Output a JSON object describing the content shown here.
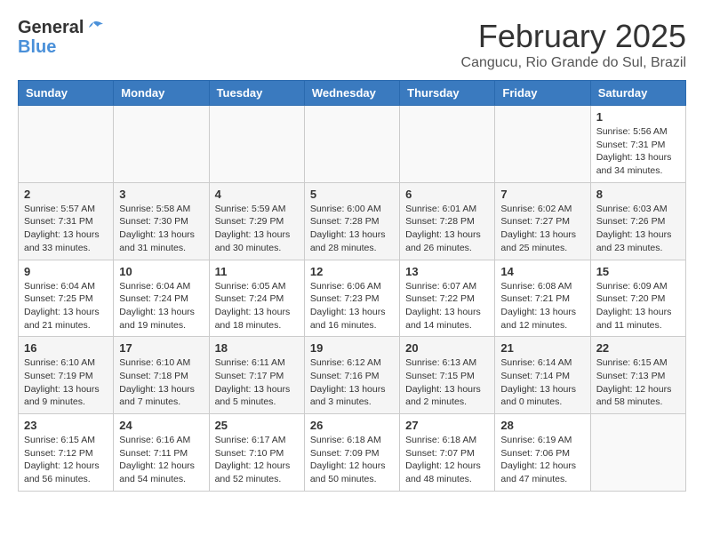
{
  "logo": {
    "line1": "General",
    "line2": "Blue"
  },
  "title": "February 2025",
  "subtitle": "Cangucu, Rio Grande do Sul, Brazil",
  "headers": [
    "Sunday",
    "Monday",
    "Tuesday",
    "Wednesday",
    "Thursday",
    "Friday",
    "Saturday"
  ],
  "weeks": [
    [
      {
        "day": "",
        "info": ""
      },
      {
        "day": "",
        "info": ""
      },
      {
        "day": "",
        "info": ""
      },
      {
        "day": "",
        "info": ""
      },
      {
        "day": "",
        "info": ""
      },
      {
        "day": "",
        "info": ""
      },
      {
        "day": "1",
        "info": "Sunrise: 5:56 AM\nSunset: 7:31 PM\nDaylight: 13 hours and 34 minutes."
      }
    ],
    [
      {
        "day": "2",
        "info": "Sunrise: 5:57 AM\nSunset: 7:31 PM\nDaylight: 13 hours and 33 minutes."
      },
      {
        "day": "3",
        "info": "Sunrise: 5:58 AM\nSunset: 7:30 PM\nDaylight: 13 hours and 31 minutes."
      },
      {
        "day": "4",
        "info": "Sunrise: 5:59 AM\nSunset: 7:29 PM\nDaylight: 13 hours and 30 minutes."
      },
      {
        "day": "5",
        "info": "Sunrise: 6:00 AM\nSunset: 7:28 PM\nDaylight: 13 hours and 28 minutes."
      },
      {
        "day": "6",
        "info": "Sunrise: 6:01 AM\nSunset: 7:28 PM\nDaylight: 13 hours and 26 minutes."
      },
      {
        "day": "7",
        "info": "Sunrise: 6:02 AM\nSunset: 7:27 PM\nDaylight: 13 hours and 25 minutes."
      },
      {
        "day": "8",
        "info": "Sunrise: 6:03 AM\nSunset: 7:26 PM\nDaylight: 13 hours and 23 minutes."
      }
    ],
    [
      {
        "day": "9",
        "info": "Sunrise: 6:04 AM\nSunset: 7:25 PM\nDaylight: 13 hours and 21 minutes."
      },
      {
        "day": "10",
        "info": "Sunrise: 6:04 AM\nSunset: 7:24 PM\nDaylight: 13 hours and 19 minutes."
      },
      {
        "day": "11",
        "info": "Sunrise: 6:05 AM\nSunset: 7:24 PM\nDaylight: 13 hours and 18 minutes."
      },
      {
        "day": "12",
        "info": "Sunrise: 6:06 AM\nSunset: 7:23 PM\nDaylight: 13 hours and 16 minutes."
      },
      {
        "day": "13",
        "info": "Sunrise: 6:07 AM\nSunset: 7:22 PM\nDaylight: 13 hours and 14 minutes."
      },
      {
        "day": "14",
        "info": "Sunrise: 6:08 AM\nSunset: 7:21 PM\nDaylight: 13 hours and 12 minutes."
      },
      {
        "day": "15",
        "info": "Sunrise: 6:09 AM\nSunset: 7:20 PM\nDaylight: 13 hours and 11 minutes."
      }
    ],
    [
      {
        "day": "16",
        "info": "Sunrise: 6:10 AM\nSunset: 7:19 PM\nDaylight: 13 hours and 9 minutes."
      },
      {
        "day": "17",
        "info": "Sunrise: 6:10 AM\nSunset: 7:18 PM\nDaylight: 13 hours and 7 minutes."
      },
      {
        "day": "18",
        "info": "Sunrise: 6:11 AM\nSunset: 7:17 PM\nDaylight: 13 hours and 5 minutes."
      },
      {
        "day": "19",
        "info": "Sunrise: 6:12 AM\nSunset: 7:16 PM\nDaylight: 13 hours and 3 minutes."
      },
      {
        "day": "20",
        "info": "Sunrise: 6:13 AM\nSunset: 7:15 PM\nDaylight: 13 hours and 2 minutes."
      },
      {
        "day": "21",
        "info": "Sunrise: 6:14 AM\nSunset: 7:14 PM\nDaylight: 13 hours and 0 minutes."
      },
      {
        "day": "22",
        "info": "Sunrise: 6:15 AM\nSunset: 7:13 PM\nDaylight: 12 hours and 58 minutes."
      }
    ],
    [
      {
        "day": "23",
        "info": "Sunrise: 6:15 AM\nSunset: 7:12 PM\nDaylight: 12 hours and 56 minutes."
      },
      {
        "day": "24",
        "info": "Sunrise: 6:16 AM\nSunset: 7:11 PM\nDaylight: 12 hours and 54 minutes."
      },
      {
        "day": "25",
        "info": "Sunrise: 6:17 AM\nSunset: 7:10 PM\nDaylight: 12 hours and 52 minutes."
      },
      {
        "day": "26",
        "info": "Sunrise: 6:18 AM\nSunset: 7:09 PM\nDaylight: 12 hours and 50 minutes."
      },
      {
        "day": "27",
        "info": "Sunrise: 6:18 AM\nSunset: 7:07 PM\nDaylight: 12 hours and 48 minutes."
      },
      {
        "day": "28",
        "info": "Sunrise: 6:19 AM\nSunset: 7:06 PM\nDaylight: 12 hours and 47 minutes."
      },
      {
        "day": "",
        "info": ""
      }
    ]
  ]
}
